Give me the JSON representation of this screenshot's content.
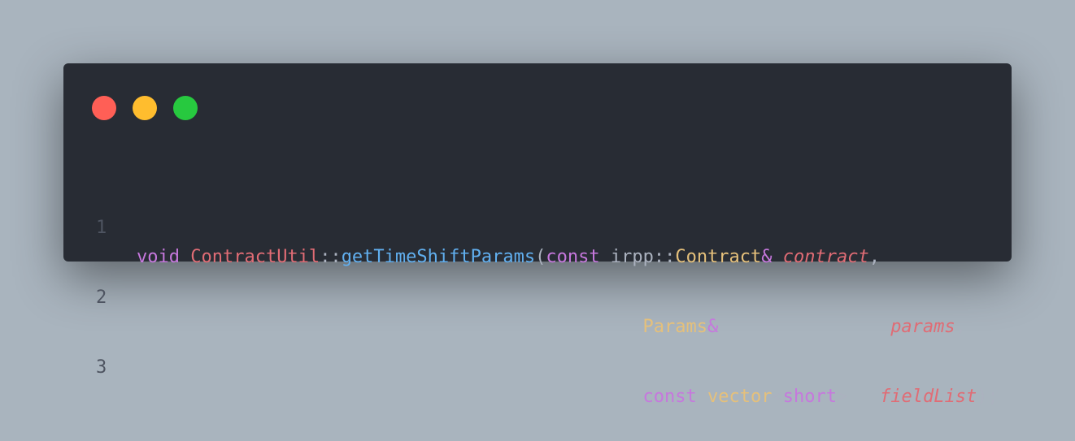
{
  "colors": {
    "background": "#a9b4be",
    "window": "#282c34",
    "close": "#ff5f56",
    "minimize": "#ffbd2e",
    "maximize": "#27c93f",
    "keyword": "#c678dd",
    "class": "#e06c75",
    "function": "#61afef",
    "type": "#e5c07b",
    "parameter": "#e06c75",
    "plain": "#abb2bf",
    "line_number": "#4e5461"
  },
  "window_controls": {
    "close": "close-dot-icon",
    "minimize": "minimize-dot-icon",
    "maximize": "maximize-dot-icon"
  },
  "code": {
    "lines": [
      {
        "number": "1",
        "tokens": [
          {
            "t": "void",
            "k": "keyword"
          },
          {
            "t": " ",
            "k": "plain"
          },
          {
            "t": "ContractUtil",
            "k": "class"
          },
          {
            "t": "::",
            "k": "punct"
          },
          {
            "t": "getTimeShiftParams",
            "k": "func"
          },
          {
            "t": "(",
            "k": "punct"
          },
          {
            "t": "const",
            "k": "keyword"
          },
          {
            "t": " irpp",
            "k": "plain"
          },
          {
            "t": "::",
            "k": "punct"
          },
          {
            "t": "Contract",
            "k": "type"
          },
          {
            "t": "&",
            "k": "keyword"
          },
          {
            "t": " ",
            "k": "plain"
          },
          {
            "t": "contract",
            "k": "param"
          },
          {
            "t": ",",
            "k": "punct"
          }
        ]
      },
      {
        "number": "2",
        "tokens": [
          {
            "t": "                                               ",
            "k": "plain"
          },
          {
            "t": "Params",
            "k": "type"
          },
          {
            "t": "&",
            "k": "keyword"
          },
          {
            "t": "                ",
            "k": "plain"
          },
          {
            "t": "params",
            "k": "param"
          },
          {
            "t": ",",
            "k": "punct"
          }
        ]
      },
      {
        "number": "3",
        "tokens": [
          {
            "t": "                                               ",
            "k": "plain"
          },
          {
            "t": "const",
            "k": "keyword"
          },
          {
            "t": " ",
            "k": "plain"
          },
          {
            "t": "vector",
            "k": "type"
          },
          {
            "t": "<",
            "k": "punct"
          },
          {
            "t": "short",
            "k": "keyword"
          },
          {
            "t": ">",
            "k": "punct"
          },
          {
            "t": "   ",
            "k": "plain"
          },
          {
            "t": "fieldList",
            "k": "param"
          },
          {
            "t": ");",
            "k": "punct"
          }
        ]
      }
    ]
  }
}
